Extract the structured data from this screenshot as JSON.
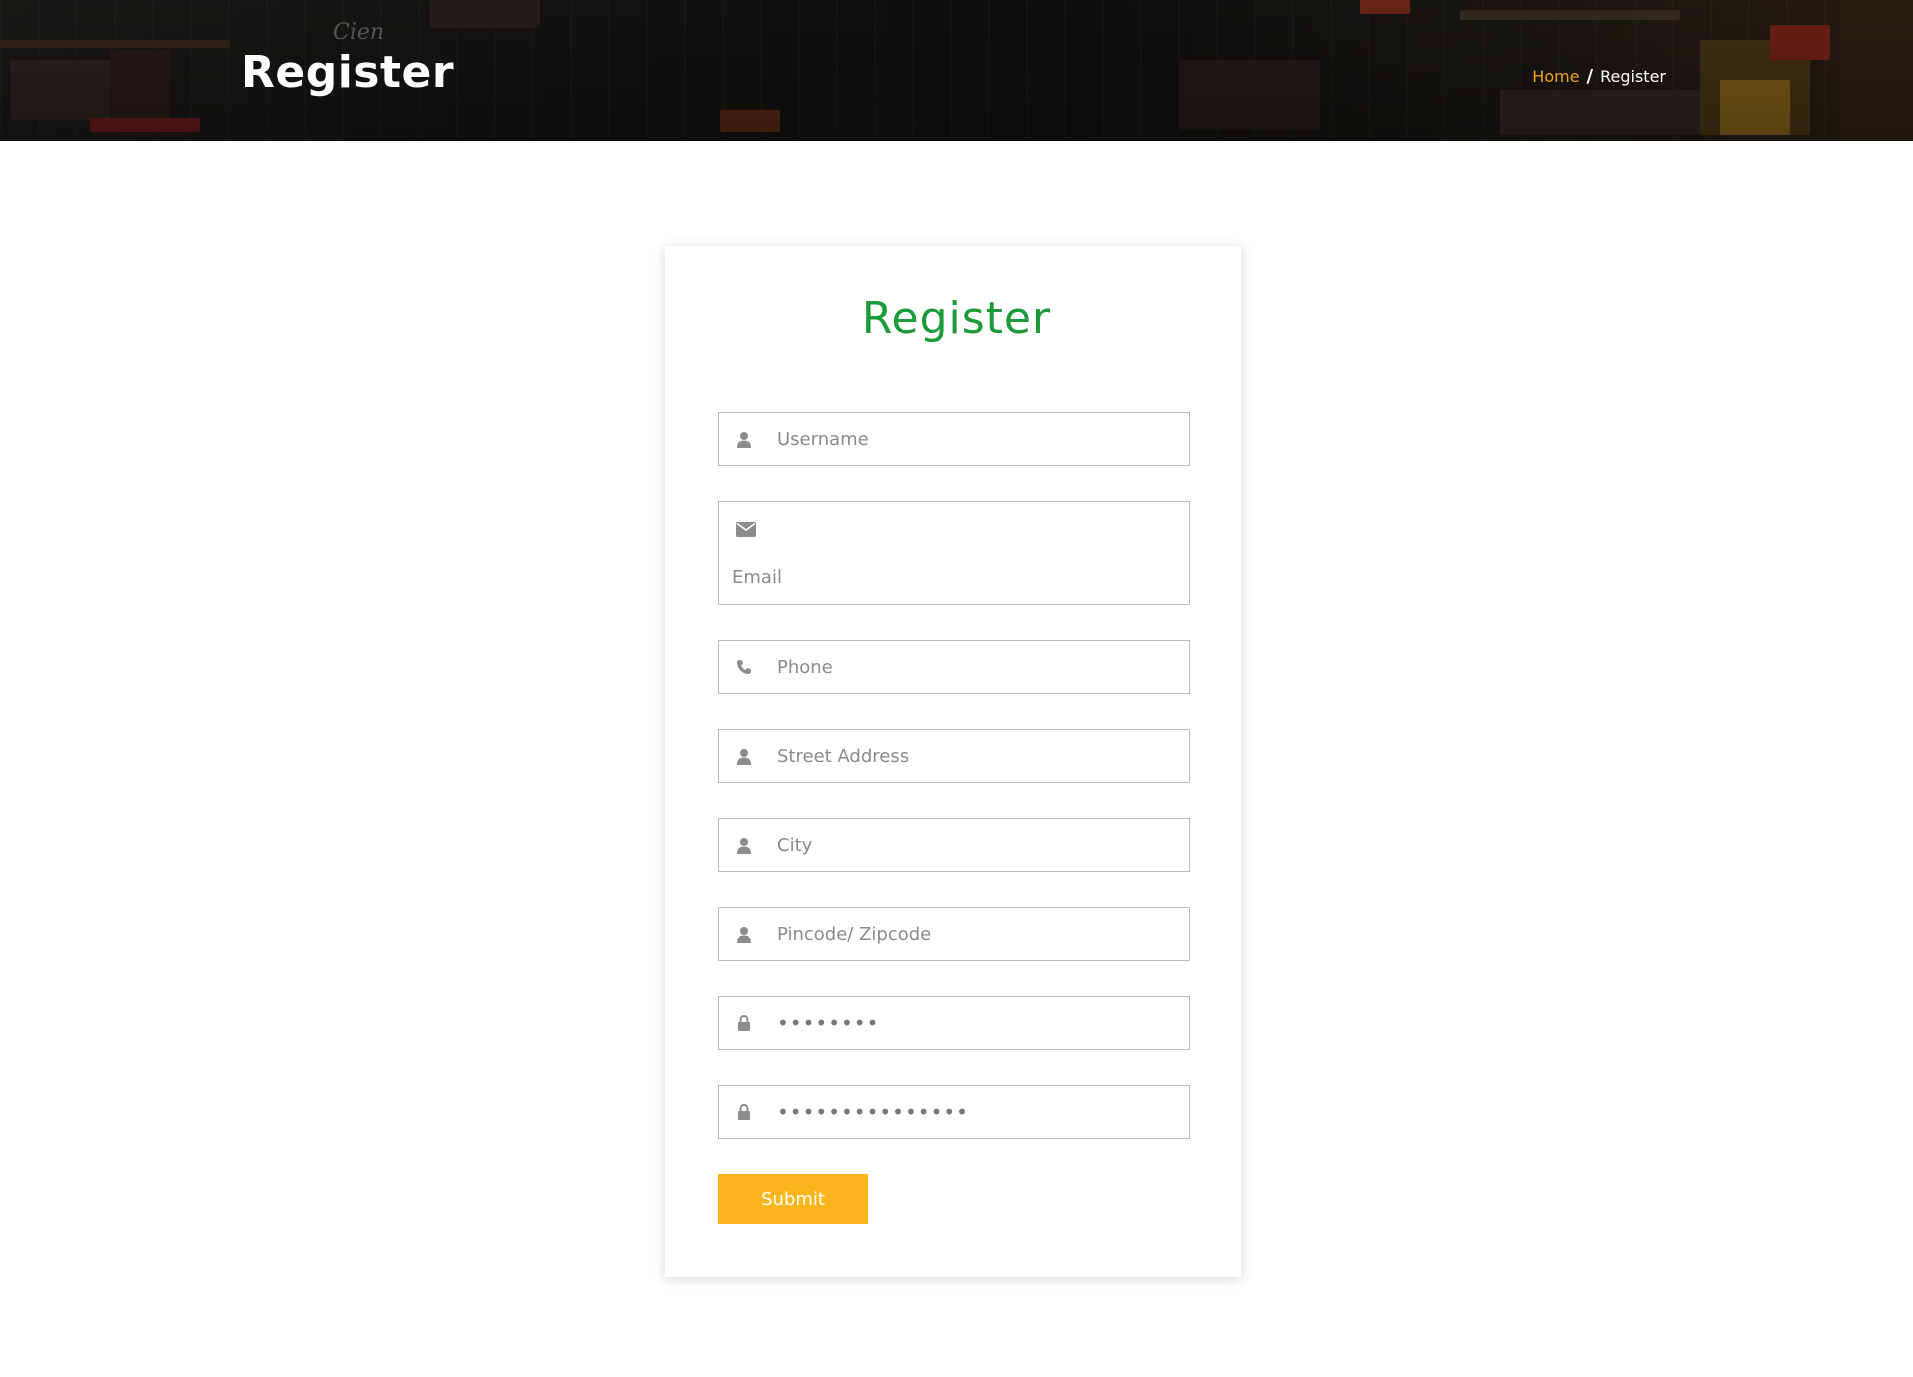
{
  "hero": {
    "logo_text": "Cien",
    "title": "Register"
  },
  "breadcrumb": {
    "home": "Home",
    "separator": "/",
    "current": "Register"
  },
  "form": {
    "title": "Register",
    "fields": {
      "username": {
        "placeholder": "Username",
        "icon": "user-icon"
      },
      "email": {
        "placeholder": "Email",
        "icon": "envelope-icon"
      },
      "phone": {
        "placeholder": "Phone",
        "icon": "phone-icon"
      },
      "street": {
        "placeholder": "Street Address",
        "icon": "user-icon"
      },
      "city": {
        "placeholder": "City",
        "icon": "user-icon"
      },
      "pincode": {
        "placeholder": "Pincode/ Zipcode",
        "icon": "user-icon"
      },
      "password": {
        "value": "••••••••",
        "icon": "lock-icon"
      },
      "confirm_password": {
        "value": "•••••••••••••••",
        "icon": "lock-icon"
      }
    },
    "submit_label": "Submit"
  },
  "colors": {
    "accent_green": "#1b9a39",
    "accent_orange": "#f2a31b",
    "submit_yellow": "#fab51c",
    "icon_gray": "#8c8c8c"
  }
}
